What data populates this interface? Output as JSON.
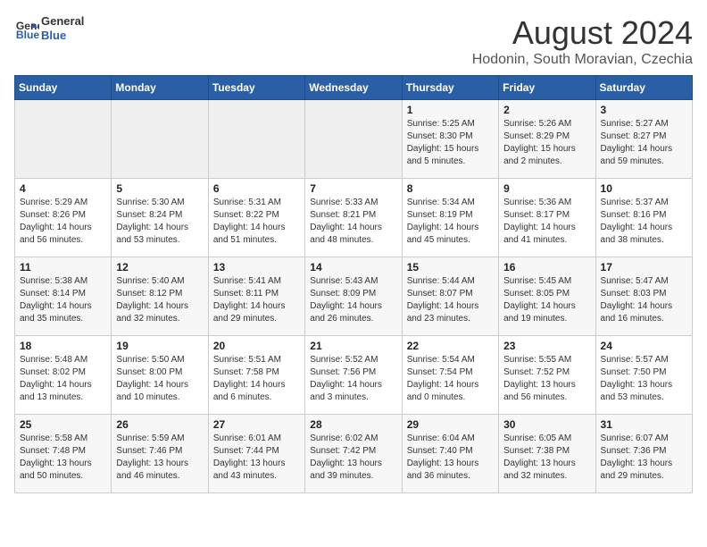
{
  "header": {
    "logo": {
      "line1": "General",
      "line2": "Blue"
    },
    "title": "August 2024",
    "subtitle": "Hodonin, South Moravian, Czechia"
  },
  "weekdays": [
    "Sunday",
    "Monday",
    "Tuesday",
    "Wednesday",
    "Thursday",
    "Friday",
    "Saturday"
  ],
  "weeks": [
    [
      {
        "day": "",
        "info": ""
      },
      {
        "day": "",
        "info": ""
      },
      {
        "day": "",
        "info": ""
      },
      {
        "day": "",
        "info": ""
      },
      {
        "day": "1",
        "info": "Sunrise: 5:25 AM\nSunset: 8:30 PM\nDaylight: 15 hours\nand 5 minutes."
      },
      {
        "day": "2",
        "info": "Sunrise: 5:26 AM\nSunset: 8:29 PM\nDaylight: 15 hours\nand 2 minutes."
      },
      {
        "day": "3",
        "info": "Sunrise: 5:27 AM\nSunset: 8:27 PM\nDaylight: 14 hours\nand 59 minutes."
      }
    ],
    [
      {
        "day": "4",
        "info": "Sunrise: 5:29 AM\nSunset: 8:26 PM\nDaylight: 14 hours\nand 56 minutes."
      },
      {
        "day": "5",
        "info": "Sunrise: 5:30 AM\nSunset: 8:24 PM\nDaylight: 14 hours\nand 53 minutes."
      },
      {
        "day": "6",
        "info": "Sunrise: 5:31 AM\nSunset: 8:22 PM\nDaylight: 14 hours\nand 51 minutes."
      },
      {
        "day": "7",
        "info": "Sunrise: 5:33 AM\nSunset: 8:21 PM\nDaylight: 14 hours\nand 48 minutes."
      },
      {
        "day": "8",
        "info": "Sunrise: 5:34 AM\nSunset: 8:19 PM\nDaylight: 14 hours\nand 45 minutes."
      },
      {
        "day": "9",
        "info": "Sunrise: 5:36 AM\nSunset: 8:17 PM\nDaylight: 14 hours\nand 41 minutes."
      },
      {
        "day": "10",
        "info": "Sunrise: 5:37 AM\nSunset: 8:16 PM\nDaylight: 14 hours\nand 38 minutes."
      }
    ],
    [
      {
        "day": "11",
        "info": "Sunrise: 5:38 AM\nSunset: 8:14 PM\nDaylight: 14 hours\nand 35 minutes."
      },
      {
        "day": "12",
        "info": "Sunrise: 5:40 AM\nSunset: 8:12 PM\nDaylight: 14 hours\nand 32 minutes."
      },
      {
        "day": "13",
        "info": "Sunrise: 5:41 AM\nSunset: 8:11 PM\nDaylight: 14 hours\nand 29 minutes."
      },
      {
        "day": "14",
        "info": "Sunrise: 5:43 AM\nSunset: 8:09 PM\nDaylight: 14 hours\nand 26 minutes."
      },
      {
        "day": "15",
        "info": "Sunrise: 5:44 AM\nSunset: 8:07 PM\nDaylight: 14 hours\nand 23 minutes."
      },
      {
        "day": "16",
        "info": "Sunrise: 5:45 AM\nSunset: 8:05 PM\nDaylight: 14 hours\nand 19 minutes."
      },
      {
        "day": "17",
        "info": "Sunrise: 5:47 AM\nSunset: 8:03 PM\nDaylight: 14 hours\nand 16 minutes."
      }
    ],
    [
      {
        "day": "18",
        "info": "Sunrise: 5:48 AM\nSunset: 8:02 PM\nDaylight: 14 hours\nand 13 minutes."
      },
      {
        "day": "19",
        "info": "Sunrise: 5:50 AM\nSunset: 8:00 PM\nDaylight: 14 hours\nand 10 minutes."
      },
      {
        "day": "20",
        "info": "Sunrise: 5:51 AM\nSunset: 7:58 PM\nDaylight: 14 hours\nand 6 minutes."
      },
      {
        "day": "21",
        "info": "Sunrise: 5:52 AM\nSunset: 7:56 PM\nDaylight: 14 hours\nand 3 minutes."
      },
      {
        "day": "22",
        "info": "Sunrise: 5:54 AM\nSunset: 7:54 PM\nDaylight: 14 hours\nand 0 minutes."
      },
      {
        "day": "23",
        "info": "Sunrise: 5:55 AM\nSunset: 7:52 PM\nDaylight: 13 hours\nand 56 minutes."
      },
      {
        "day": "24",
        "info": "Sunrise: 5:57 AM\nSunset: 7:50 PM\nDaylight: 13 hours\nand 53 minutes."
      }
    ],
    [
      {
        "day": "25",
        "info": "Sunrise: 5:58 AM\nSunset: 7:48 PM\nDaylight: 13 hours\nand 50 minutes."
      },
      {
        "day": "26",
        "info": "Sunrise: 5:59 AM\nSunset: 7:46 PM\nDaylight: 13 hours\nand 46 minutes."
      },
      {
        "day": "27",
        "info": "Sunrise: 6:01 AM\nSunset: 7:44 PM\nDaylight: 13 hours\nand 43 minutes."
      },
      {
        "day": "28",
        "info": "Sunrise: 6:02 AM\nSunset: 7:42 PM\nDaylight: 13 hours\nand 39 minutes."
      },
      {
        "day": "29",
        "info": "Sunrise: 6:04 AM\nSunset: 7:40 PM\nDaylight: 13 hours\nand 36 minutes."
      },
      {
        "day": "30",
        "info": "Sunrise: 6:05 AM\nSunset: 7:38 PM\nDaylight: 13 hours\nand 32 minutes."
      },
      {
        "day": "31",
        "info": "Sunrise: 6:07 AM\nSunset: 7:36 PM\nDaylight: 13 hours\nand 29 minutes."
      }
    ]
  ]
}
